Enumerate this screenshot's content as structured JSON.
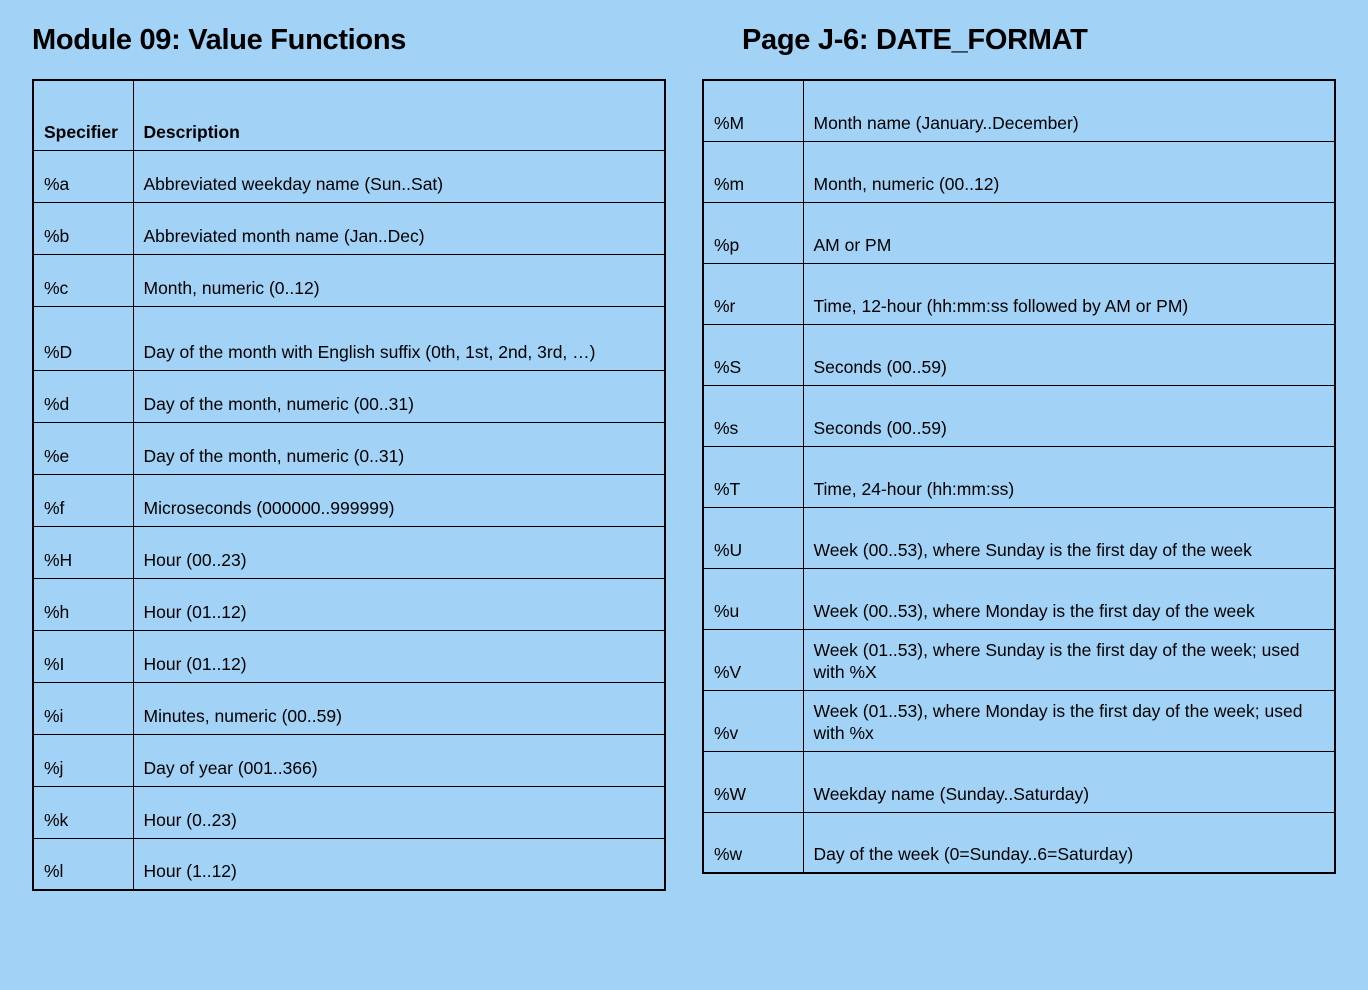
{
  "leftTitle": "Module 09: Value Functions",
  "rightTitle": "Page J-6: DATE_FORMAT",
  "headers": {
    "specifier": "Specifier",
    "description": "Description"
  },
  "leftRows": [
    {
      "spec": "%a",
      "desc": "Abbreviated weekday name (Sun..Sat)"
    },
    {
      "spec": "%b",
      "desc": "Abbreviated month name (Jan..Dec)"
    },
    {
      "spec": "%c",
      "desc": "Month, numeric (0..12)"
    },
    {
      "spec": "%D",
      "desc": "Day of the month with English suffix (0th, 1st, 2nd, 3rd, …)",
      "tall": true
    },
    {
      "spec": "%d",
      "desc": "Day of the month, numeric (00..31)"
    },
    {
      "spec": "%e",
      "desc": "Day of the month, numeric (0..31)"
    },
    {
      "spec": "%f",
      "desc": "Microseconds (000000..999999)"
    },
    {
      "spec": "%H",
      "desc": "Hour (00..23)"
    },
    {
      "spec": "%h",
      "desc": "Hour (01..12)"
    },
    {
      "spec": "%I",
      "desc": "Hour (01..12)"
    },
    {
      "spec": "%i",
      "desc": "Minutes, numeric (00..59)"
    },
    {
      "spec": "%j",
      "desc": "Day of year (001..366)"
    },
    {
      "spec": "%k",
      "desc": "Hour (0..23)"
    },
    {
      "spec": "%l",
      "desc": "Hour (1..12)"
    }
  ],
  "rightRows": [
    {
      "spec": "%M",
      "desc": "Month name (January..December)"
    },
    {
      "spec": "%m",
      "desc": "Month, numeric (00..12)"
    },
    {
      "spec": "%p",
      "desc": "AM or PM"
    },
    {
      "spec": "%r",
      "desc": "Time, 12-hour (hh:mm:ss followed by AM or PM)"
    },
    {
      "spec": "%S",
      "desc": "Seconds (00..59)"
    },
    {
      "spec": "%s",
      "desc": "Seconds (00..59)"
    },
    {
      "spec": "%T",
      "desc": "Time, 24-hour (hh:mm:ss)"
    },
    {
      "spec": "%U",
      "desc": "Week (00..53), where Sunday is the first day of the week"
    },
    {
      "spec": "%u",
      "desc": "Week (00..53), where Monday is the first day of the week"
    },
    {
      "spec": "%V",
      "desc": "Week (01..53), where Sunday is the first day of the week; used with %X",
      "tall": true
    },
    {
      "spec": "%v",
      "desc": "Week (01..53), where Monday is the first day of the week; used with %x",
      "tall": true
    },
    {
      "spec": "%W",
      "desc": "Weekday name (Sunday..Saturday)"
    },
    {
      "spec": "%w",
      "desc": "Day of the week (0=Sunday..6=Saturday)"
    }
  ]
}
